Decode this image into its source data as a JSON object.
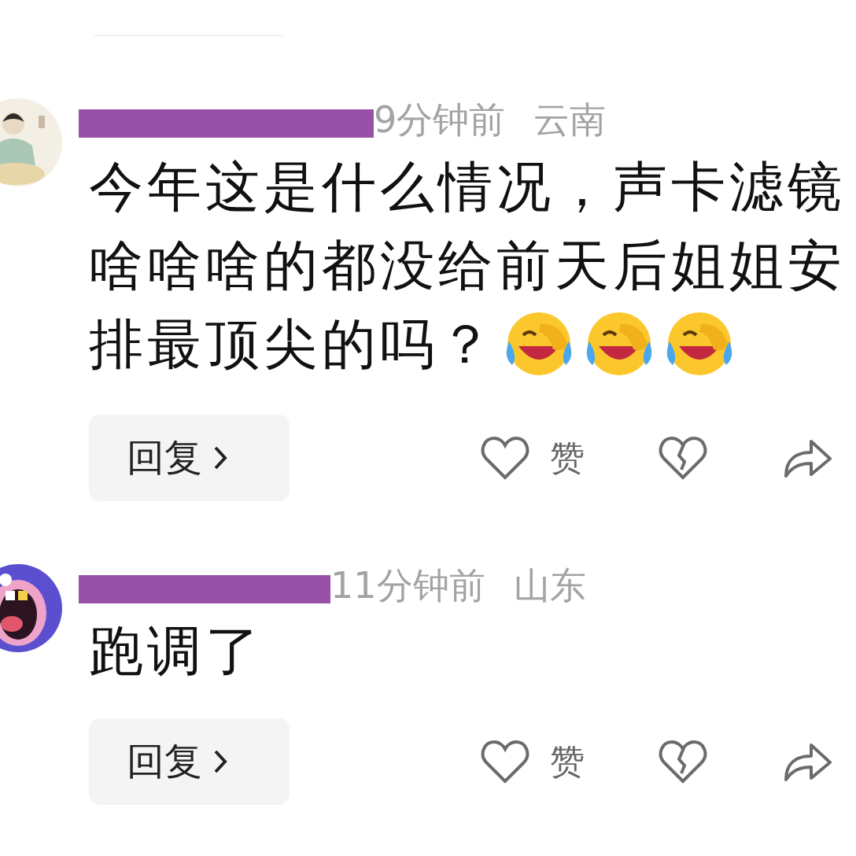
{
  "comments": [
    {
      "avatar": {
        "kind": "picture",
        "color": "#f3efe4"
      },
      "name_redacted": true,
      "time": "9分钟前",
      "location": "云南",
      "text_lines": [
        "今年这是什么情况，声卡滤镜",
        "啥啥啥的都没给前天后姐姐安",
        "排最顶尖的吗？"
      ],
      "emojis": [
        {
          "kind": "laughing-crying"
        },
        {
          "kind": "laughing-crying"
        },
        {
          "kind": "laughing-crying"
        }
      ],
      "reply": "回复",
      "like": "赞"
    },
    {
      "avatar": {
        "kind": "picture",
        "color": "#5b4fd0"
      },
      "name_redacted": true,
      "time": "11分钟前",
      "location": "山东",
      "text_lines": [
        "跑调了"
      ],
      "reply": "回复",
      "like": "赞"
    }
  ]
}
